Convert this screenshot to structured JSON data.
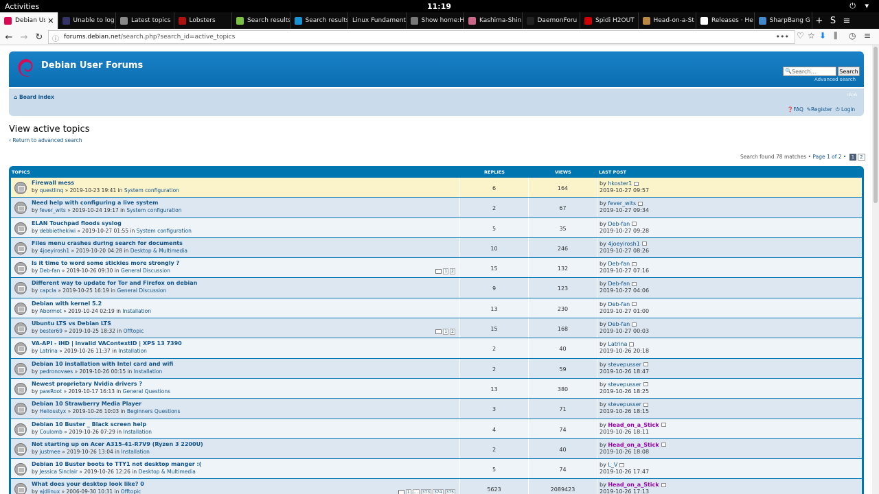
{
  "topbar": {
    "activities": "Activities",
    "clock": "11:19",
    "tray": "⏻ ▾"
  },
  "browser": {
    "tabs": [
      {
        "label": "Debian Use",
        "icon": "debian-icon",
        "color": "#d70a53",
        "active": true
      },
      {
        "label": "Unable to log",
        "icon": "dark-site-icon",
        "color": "#333366"
      },
      {
        "label": "Latest topics",
        "icon": "triangle-icon",
        "color": "#888888"
      },
      {
        "label": "Lobsters",
        "icon": "lobsters-icon",
        "color": "#ac130d"
      },
      {
        "label": "Search results",
        "icon": "arrow-icon",
        "color": "#7ac143"
      },
      {
        "label": "Search results",
        "icon": "arch-icon",
        "color": "#1793d1"
      },
      {
        "label": "Linux Fundament",
        "icon": "",
        "color": ""
      },
      {
        "label": "Show home:H",
        "icon": "folder-icon",
        "color": "#777777"
      },
      {
        "label": "Kashima-Shin",
        "icon": "anime-icon",
        "color": "#cc6688"
      },
      {
        "label": "DaemonForu",
        "icon": "daemon-icon",
        "color": "#222222"
      },
      {
        "label": "Spidi H2OUT",
        "icon": "spidi-icon",
        "color": "#cc0000"
      },
      {
        "label": "Head-on-a-St",
        "icon": "stick-icon",
        "color": "#bb8844"
      },
      {
        "label": "Releases · He",
        "icon": "github-icon",
        "color": "#ffffff"
      },
      {
        "label": "SharpBang G",
        "icon": "sharp-icon",
        "color": "#4488cc"
      }
    ],
    "new_tab": "+",
    "extension": "S",
    "menu": "≡",
    "url_host": "forums.debian.net",
    "url_path": "/search.php?search_id=active_topics"
  },
  "forum": {
    "site_name": "Debian User Forums",
    "search_placeholder": "Search…",
    "search_button": "Search",
    "advanced_search": "Advanced search",
    "board_index": "Board index",
    "font_size": "‹A›A",
    "faq": "FAQ",
    "register": "Register",
    "login": "Login",
    "page_title": "View active topics",
    "return_link": "Return to advanced search",
    "search_found": "Search found 78 matches •",
    "page_of": "Page 1 of 2 •",
    "pages": [
      "1",
      "2"
    ],
    "col_topics": "TOPICS",
    "col_replies": "REPLIES",
    "col_views": "VIEWS",
    "col_last_post": "LAST POST",
    "topics": [
      {
        "title": "Firewall mess",
        "author": "questlinq",
        "date": "2019-10-23 19:41",
        "forum": "System configuration",
        "replies": "6",
        "views": "164",
        "lp_user": "hkoster1",
        "lp_rank": "",
        "lp_date": "2019-10-27 09:57",
        "highlight": true,
        "pages": []
      },
      {
        "title": "Need help with configuring a live system",
        "author": "fever_wits",
        "date": "2019-10-24 19:17",
        "forum": "System configuration",
        "replies": "2",
        "views": "67",
        "lp_user": "fever_wits",
        "lp_rank": "",
        "lp_date": "2019-10-27 09:34",
        "highlight": false,
        "pages": []
      },
      {
        "title": "ELAN Touchpad floods syslog",
        "author": "debbiethekiwi",
        "date": "2019-10-27 01:55",
        "forum": "System configuration",
        "replies": "5",
        "views": "35",
        "lp_user": "Deb-fan",
        "lp_rank": "",
        "lp_date": "2019-10-27 09:28",
        "highlight": false,
        "pages": []
      },
      {
        "title": "Files menu crashes during search for documents",
        "author": "4joeyirosh1",
        "date": "2019-10-20 04:28",
        "forum": "Desktop & Multimedia",
        "replies": "10",
        "views": "246",
        "lp_user": "4joeyirosh1",
        "lp_rank": "",
        "lp_date": "2019-10-27 08:26",
        "highlight": false,
        "pages": []
      },
      {
        "title": "Is it time to word some stickies more strongly ?",
        "author": "Deb-fan",
        "date": "2019-10-26 09:30",
        "forum": "General Discussion",
        "replies": "15",
        "views": "132",
        "lp_user": "Deb-fan",
        "lp_rank": "",
        "lp_date": "2019-10-27 07:16",
        "highlight": false,
        "pages": [
          "1",
          "2"
        ]
      },
      {
        "title": "Different way to update for Tor and Firefox on debian",
        "author": "capcla",
        "date": "2019-10-25 16:19",
        "forum": "General Discussion",
        "replies": "9",
        "views": "123",
        "lp_user": "Deb-fan",
        "lp_rank": "",
        "lp_date": "2019-10-27 04:06",
        "highlight": false,
        "pages": []
      },
      {
        "title": "Debian with kernel 5.2",
        "author": "Abormot",
        "date": "2019-10-24 02:19",
        "forum": "Installation",
        "replies": "13",
        "views": "230",
        "lp_user": "Deb-fan",
        "lp_rank": "",
        "lp_date": "2019-10-27 01:00",
        "highlight": false,
        "pages": []
      },
      {
        "title": "Ubuntu LTS vs Debian LTS",
        "author": "bester69",
        "date": "2019-10-25 18:32",
        "forum": "Offtopic",
        "replies": "15",
        "views": "168",
        "lp_user": "Deb-fan",
        "lp_rank": "",
        "lp_date": "2019-10-27 00:03",
        "highlight": false,
        "pages": [
          "1",
          "2"
        ]
      },
      {
        "title": "VA-API - iHD | invalid VAContextID | XPS 13 7390",
        "author": "Latrina",
        "date": "2019-10-26 11:37",
        "forum": "Installation",
        "replies": "2",
        "views": "40",
        "lp_user": "Latrina",
        "lp_rank": "",
        "lp_date": "2019-10-26 20:18",
        "highlight": false,
        "pages": []
      },
      {
        "title": "Debian 10 installation with Intel card and wifi",
        "author": "pedronovaes",
        "date": "2019-10-26 00:15",
        "forum": "Installation",
        "replies": "2",
        "views": "59",
        "lp_user": "stevepusser",
        "lp_rank": "",
        "lp_date": "2019-10-26 18:47",
        "highlight": false,
        "pages": []
      },
      {
        "title": "Newest proprietary Nvidia drivers ?",
        "author": "pawRoot",
        "date": "2019-10-17 16:13",
        "forum": "General Questions",
        "replies": "13",
        "views": "380",
        "lp_user": "stevepusser",
        "lp_rank": "",
        "lp_date": "2019-10-26 18:25",
        "highlight": false,
        "pages": []
      },
      {
        "title": "Debian 10 Strawberry Media Player",
        "author": "Heliosstyx",
        "date": "2019-10-26 10:03",
        "forum": "Beginners Questions",
        "replies": "3",
        "views": "71",
        "lp_user": "stevepusser",
        "lp_rank": "",
        "lp_date": "2019-10-26 18:15",
        "highlight": false,
        "pages": []
      },
      {
        "title": "Debian 10 Buster _ Black screen help",
        "author": "Coulomb",
        "date": "2019-10-26 07:29",
        "forum": "Installation",
        "replies": "4",
        "views": "74",
        "lp_user": "Head_on_a_Stick",
        "lp_rank": "mod",
        "lp_date": "2019-10-26 18:11",
        "highlight": false,
        "pages": []
      },
      {
        "title": "Not starting up on Acer A315-41-R7V9 (Ryzen 3 2200U)",
        "author": "justmee",
        "date": "2019-10-26 13:04",
        "forum": "Installation",
        "replies": "2",
        "views": "40",
        "lp_user": "Head_on_a_Stick",
        "lp_rank": "mod",
        "lp_date": "2019-10-26 18:08",
        "highlight": false,
        "pages": []
      },
      {
        "title": "Debian 10 Buster boots to TTY1 not desktop manger :(",
        "author": "Jessica Sinclair",
        "date": "2019-10-26 12:26",
        "forum": "Desktop & Multimedia",
        "replies": "5",
        "views": "74",
        "lp_user": "L_V",
        "lp_rank": "",
        "lp_date": "2019-10-26 17:47",
        "highlight": false,
        "pages": []
      },
      {
        "title": "What does your desktop look like? 0",
        "author": "ajdlinux",
        "date": "2006-09-30 10:31",
        "forum": "Offtopic",
        "replies": "5623",
        "views": "2089423",
        "lp_user": "Head_on_a_Stick",
        "lp_rank": "mod",
        "lp_date": "2019-10-26 17:13",
        "highlight": false,
        "pages": [
          "1",
          "…",
          "373",
          "374",
          "375"
        ]
      }
    ]
  }
}
